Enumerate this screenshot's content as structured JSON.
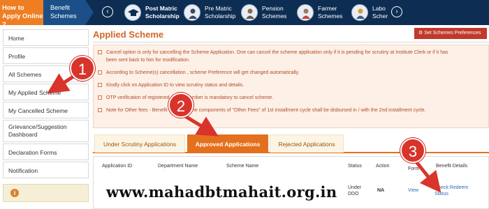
{
  "topbar": {
    "apply_label": "How to Apply Online ?",
    "benefit_label": "Benefit Schemes",
    "prev_icon": "chevron-left-icon",
    "next_icon": "chevron-right-icon",
    "items": [
      {
        "label": "Post Matric",
        "label2": "Scholarship",
        "icon": "graduation-cap-icon"
      },
      {
        "label": "Pre Matric",
        "label2": "Scholarship",
        "icon": "student-icon"
      },
      {
        "label": "Pension",
        "label2": "Schemes",
        "icon": "elderly-person-icon"
      },
      {
        "label": "Farmer",
        "label2": "Schemes",
        "icon": "farmer-icon"
      },
      {
        "label": "Labo",
        "label2": "Scher",
        "icon": "labour-icon"
      }
    ]
  },
  "sidebar": {
    "items": [
      {
        "label": "Home"
      },
      {
        "label": "Profile"
      },
      {
        "label": "All Schemes"
      },
      {
        "label": "My Applied Scheme"
      },
      {
        "label": "My Cancelled Scheme"
      },
      {
        "label": "Grievance/Suggestion Dashboard"
      },
      {
        "label": "Declaration Forms"
      },
      {
        "label": "Notification"
      }
    ],
    "info_icon": "info-icon"
  },
  "main": {
    "title": "Applied Scheme",
    "set_preferences": "Set Schemes Preferences",
    "notes": [
      "Cancel option is only for cancelling the Scheme Application. One can cancel the scheme application only if it is pending for scrutiny at Institute Clerk or if it has",
      "been sent back to him for modification.",
      "According to Scheme(s) cancellation , scheme Preference will get changed automatically.",
      "Kindly click on Application ID to view scrutiny status and details.",
      "OTP verification of registered mobile number is mandatory to cancel scheme.",
      "Note for Other fees - Benefit regarding the components of \"Other Fees\" of 1st installment cycle shall be disbursed in / with the 2nd installment cycle."
    ],
    "tabs": [
      "Under Scrutiny Applications",
      "Approved Applications",
      "Rejected Applications"
    ],
    "active_tab": "Approved Applications",
    "table": {
      "headers": [
        "Application ID",
        "Department Name",
        "Scheme Name",
        "Status",
        "Action",
        "View",
        "Form",
        "Benefit Details"
      ],
      "row": {
        "status_line1": "Under",
        "status_line2": "DDO",
        "action": "NA",
        "view": "View",
        "benefit_line1": "Check Redeem",
        "benefit_line2": "Status"
      }
    }
  },
  "annotations": {
    "step1": "1",
    "step2": "2",
    "step3": "3",
    "arrow_color": "#d9342b"
  },
  "watermark": "www.mahadbtmahait.org.in"
}
